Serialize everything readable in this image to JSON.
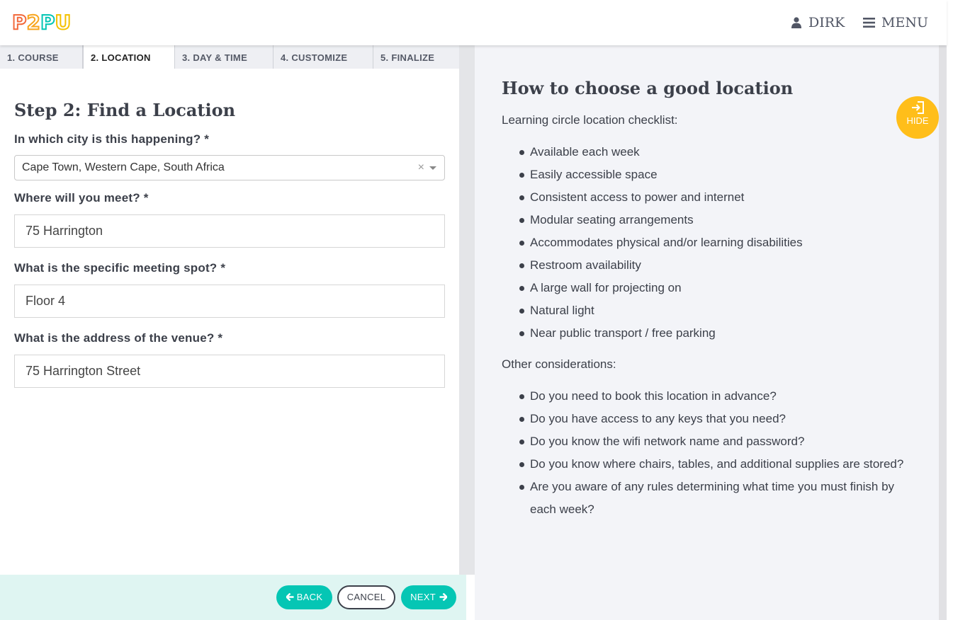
{
  "header": {
    "logo_letters": [
      "P",
      "2",
      "P",
      "U"
    ],
    "user_name": "DIRK",
    "menu_label": "MENU",
    "icons": {
      "user": "user-icon",
      "menu": "hamburger-icon"
    }
  },
  "tabs": [
    {
      "label": "1. COURSE",
      "active": false
    },
    {
      "label": "2. LOCATION",
      "active": true
    },
    {
      "label": "3. DAY & TIME",
      "active": false
    },
    {
      "label": "4. CUSTOMIZE",
      "active": false
    },
    {
      "label": "5. FINALIZE",
      "active": false
    }
  ],
  "form": {
    "title": "Step 2: Find a Location",
    "city_label": "In which city is this happening? *",
    "city_value": "Cape Town, Western Cape, South Africa",
    "city_clear": "×",
    "venue_label": "Where will you meet? *",
    "venue_value": "75 Harrington",
    "spot_label": "What is the specific meeting spot? *",
    "spot_value": "Floor 4",
    "address_label": "What is the address of the venue? *",
    "address_value": "75 Harrington Street"
  },
  "footer": {
    "back_label": "BACK",
    "cancel_label": "CANCEL",
    "next_label": "NEXT"
  },
  "help": {
    "title": "How to choose a good location",
    "checklist_intro": "Learning circle location checklist:",
    "checklist": [
      "Available each week",
      "Easily accessible space",
      "Consistent access to power and internet",
      "Modular seating arrangements",
      "Accommodates physical and/or learning disabilities",
      "Restroom availability",
      "A large wall for projecting on",
      "Natural light",
      "Near public transport / free parking"
    ],
    "other_intro": "Other considerations:",
    "other": [
      "Do you need to book this location in advance?",
      "Do you have access to any keys that you need?",
      "Do you know the wifi network name and password?",
      "Do you know where chairs, tables, and additional supplies are stored?",
      "Are you aware of any rules determining what time you must finish by each week?"
    ],
    "hide_label": "HIDE"
  },
  "colors": {
    "teal": "#05c6b4",
    "yellow": "#ffbe1a",
    "text": "#3c404a",
    "panel": "#f3f4f8"
  }
}
